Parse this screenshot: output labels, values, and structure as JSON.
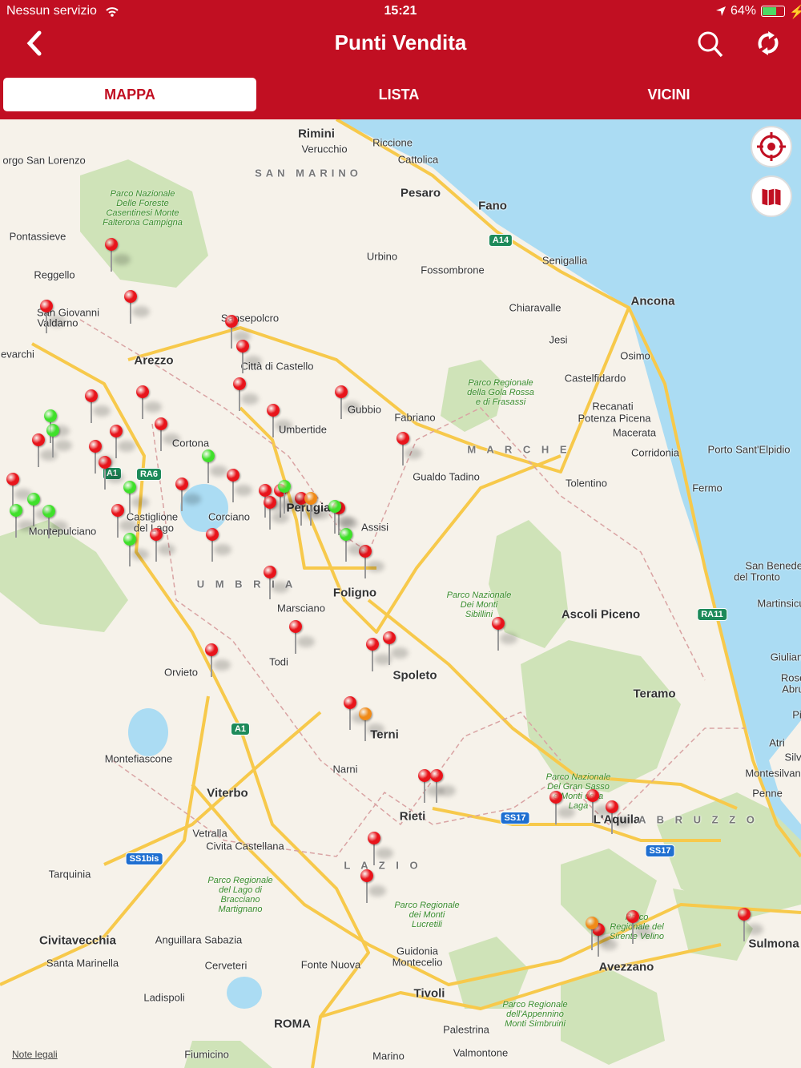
{
  "status_bar": {
    "carrier": "Nessun servizio",
    "time": "15:21",
    "battery": "64%",
    "battery_level": 0.64
  },
  "header": {
    "title": "Punti Vendita",
    "back_icon": "chevron-left-icon",
    "search_icon": "search-icon",
    "refresh_icon": "refresh-icon"
  },
  "tabs": [
    {
      "label": "MAPPA",
      "active": true
    },
    {
      "label": "LISTA",
      "active": false
    },
    {
      "label": "VICINI",
      "active": false
    }
  ],
  "map_controls": {
    "locate_icon": "crosshair-icon",
    "map_type_icon": "map-icon"
  },
  "colors": {
    "brand": "#c10f22",
    "pin_red": "#e8141b",
    "pin_green": "#3fe02a",
    "pin_orange": "#f08a17",
    "sea": "#abdcf3",
    "land": "#f6f2ea",
    "park": "#cfe3b8",
    "road": "#f7c94b"
  },
  "places": [
    "Rimini",
    "Riccione",
    "Verucchio",
    "Cattolica",
    "SAN MARINO",
    "Pesaro",
    "Fano",
    "orgo San Lorenzo",
    "Urbino",
    "Fossombrone",
    "Senigallia",
    "Pontassieve",
    "Reggello",
    "San Giovanni",
    "Valdarno",
    "Chiaravalle",
    "Ancona",
    "Sansepolcro",
    "Jesi",
    "Osimo",
    "Arezzo",
    "Città di Castello",
    "Castelfidardo",
    "Gubbio",
    "Fabriano",
    "Recanati",
    "Potenza Picena",
    "Macerata",
    "Umbertide",
    "Cortona",
    "M A R C H E",
    "Corridonia",
    "Porto Sant'Elpidio",
    "Gualdo Tadino",
    "Tolentino",
    "Fermo",
    "Perugia",
    "Corciano",
    "Castiglione",
    "del Lago",
    "Montepulciano",
    "Assisi",
    "U M B R I A",
    "Foligno",
    "San Benedet",
    "del Tronto",
    "Martinsicu",
    "Marsciano",
    "Ascoli Piceno",
    "Todi",
    "Orvieto",
    "Spoleto",
    "Teramo",
    "Terni",
    "Montefiascone",
    "Narni",
    "Montesilvan",
    "Atri",
    "Viterbo",
    "Penne",
    "Rieti",
    "L'Aquila",
    "A B R U Z Z O",
    "Vetralla",
    "Civita Castellana",
    "L A Z I O",
    "Tarquinia",
    "Civitavecchia",
    "Anguillara Sabazia",
    "Sulmona",
    "Santa Marinella",
    "Cerveteri",
    "Guidonia",
    "Montecelio",
    "Fonte Nuova",
    "Avezzano",
    "Tivoli",
    "Ladispoli",
    "ROMA",
    "Palestrina",
    "Valmontone",
    "Fiumicino",
    "Marino",
    "Giulian",
    "Rose",
    "Abru",
    "Silv",
    "evarchi",
    "Pi"
  ],
  "parks": [
    "Parco Nazionale\nDelle Foreste\nCasentinesi Monte\nFalterona Campigna",
    "Parco Regionale\ndella Gola Rossa\ne di Frasassi",
    "Parco Nazionale\nDei Monti\nSibillini",
    "Parco Nazionale\nDel Gran Sasso\ne Monti della\nLaga",
    "Parco Regionale\ndel Lago di\nBracciano\nMartignano",
    "Parco Regionale\ndei Monti\nLucretili",
    "Parco\nRegionale del\nSirente Velino",
    "Parco Regionale\ndell'Appennino\nMonti Simbruini"
  ],
  "road_shields": [
    {
      "label": "A14",
      "color": "#1d8a5a"
    },
    {
      "label": "A1",
      "color": "#1d8a5a"
    },
    {
      "label": "RA6",
      "color": "#1d8a5a"
    },
    {
      "label": "A1",
      "color": "#1d8a5a"
    },
    {
      "label": "SS17",
      "color": "#1f6fd1"
    },
    {
      "label": "SS17",
      "color": "#1f6fd1"
    },
    {
      "label": "SS1bis",
      "color": "#1f6fd1"
    },
    {
      "label": "RA11",
      "color": "#1d8a5a"
    }
  ],
  "pins": [
    "red",
    "red",
    "red",
    "red",
    "red",
    "red",
    "red",
    "red",
    "red",
    "red",
    "red",
    "red",
    "red",
    "red",
    "red",
    "red",
    "red",
    "red",
    "red",
    "red",
    "red",
    "red",
    "red",
    "red",
    "red",
    "red",
    "red",
    "red",
    "red",
    "red",
    "red",
    "red",
    "red",
    "red",
    "red",
    "red",
    "red",
    "red",
    "red",
    "red",
    "red",
    "red",
    "red",
    "red",
    "red",
    "green",
    "green",
    "green",
    "green",
    "green",
    "green",
    "green",
    "green",
    "green",
    "green",
    "green",
    "orange",
    "orange",
    "orange"
  ],
  "legal_link": "Note legali"
}
